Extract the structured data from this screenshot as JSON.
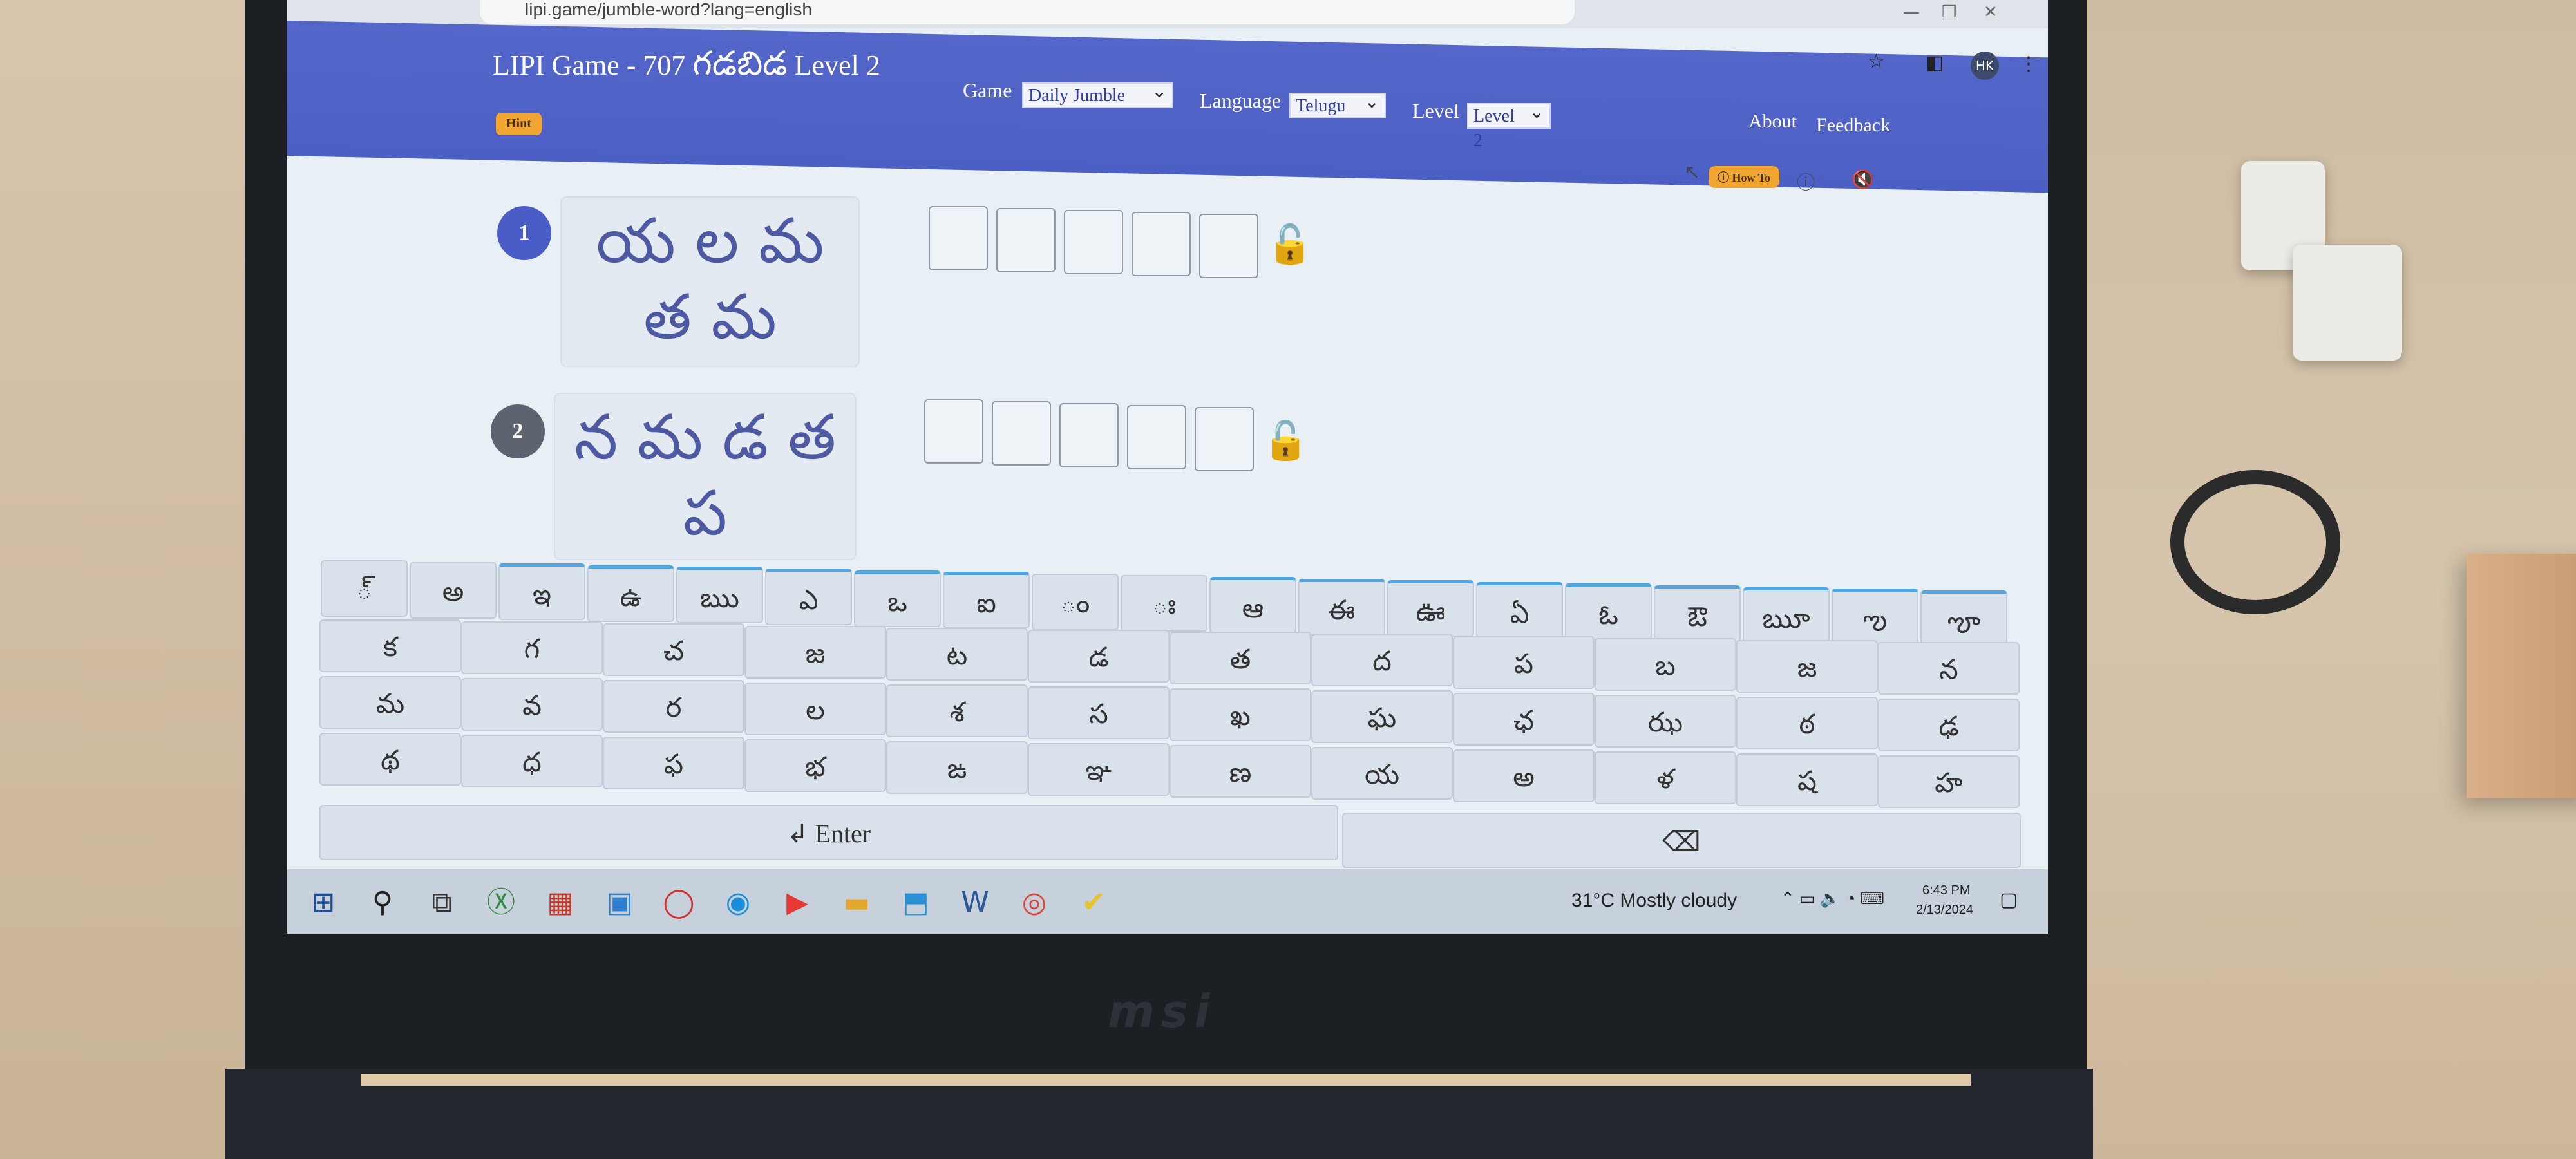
{
  "browser": {
    "url": "lipi.game/jumble-word?lang=english",
    "controls": {
      "minimize": "—",
      "restore": "❐",
      "close": "✕"
    },
    "toolbar_icons": [
      "star-icon",
      "sidebar-icon",
      "profile-avatar",
      "menu-dots-icon"
    ],
    "avatar_initials": "HK"
  },
  "header": {
    "title": "LIPI Game - 707",
    "title_telugu": "గడబిడ",
    "title_level": "Level 2",
    "game_label": "Game",
    "game_value": "Daily Jumble",
    "language_label": "Language",
    "language_value": "Telugu",
    "level_label": "Level",
    "level_value": "Level 2",
    "about": "About",
    "feedback": "Feedback"
  },
  "buttons": {
    "hint": "Hint",
    "how_to": "How To",
    "how_to_icon": "question-circle-icon",
    "info_icon": "info-icon",
    "sound_icon": "mute-speaker-icon"
  },
  "puzzles": [
    {
      "number": "1",
      "line1": "య ల మ",
      "line2": "త మ",
      "boxes": 5,
      "badge_color": "#4a5cc5"
    },
    {
      "number": "2",
      "line1": "న మ డ త",
      "line2": "ప",
      "boxes": 5,
      "badge_color": "#5d6470"
    }
  ],
  "keyboard": {
    "row1": [
      "్",
      "అ",
      "ఇ",
      "ఉ",
      "ఋ",
      "ఎ",
      "ఒ",
      "ఐ",
      "ం",
      "ః",
      "ఆ",
      "ఈ",
      "ఊ",
      "ఏ",
      "ఓ",
      "ఔ",
      "ౠ",
      "ఌ",
      "ౡ"
    ],
    "row2": [
      "క",
      "గ",
      "చ",
      "జ",
      "ట",
      "డ",
      "త",
      "ద",
      "ప",
      "బ",
      "జ",
      "న"
    ],
    "row3": [
      "మ",
      "వ",
      "ర",
      "ల",
      "శ",
      "స",
      "ఖ",
      "ఘ",
      "ఛ",
      "ఝ",
      "ఠ",
      "ఢ"
    ],
    "row4": [
      "థ",
      "ధ",
      "ఫ",
      "భ",
      "ఙ",
      "ఞ",
      "ణ",
      "య",
      "అ",
      "ళ",
      "ష",
      "హ"
    ],
    "enter": "↲ Enter",
    "backspace": "⌫"
  },
  "taskbar": {
    "weather": "31°C  Mostly cloudy",
    "time": "6:43 PM",
    "date": "2/13/2024",
    "apps": [
      "windows-start-icon",
      "search-icon",
      "task-view-icon",
      "xbox-icon",
      "flag-app-icon",
      "files-app-icon",
      "opera-icon",
      "edge-icon",
      "youtube-icon",
      "file-explorer-icon",
      "app-installer-icon",
      "word-icon",
      "chrome-icon",
      "tasks-app-icon"
    ]
  },
  "laptop_brand": "msi"
}
